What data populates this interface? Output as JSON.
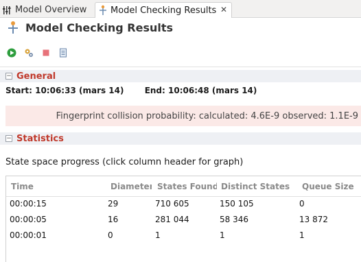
{
  "tabs": [
    {
      "label": "Model Overview",
      "icon": "model-overview-icon",
      "active": false
    },
    {
      "label": "Model Checking Results",
      "icon": "model-checking-icon",
      "active": true,
      "close": "✕"
    }
  ],
  "title": "Model Checking Results",
  "toolbar": [
    "run-icon",
    "settings-icon",
    "stop-icon",
    "document-icon"
  ],
  "general": {
    "header": "General",
    "toggle": "−",
    "start": "Start: 10:06:33 (mars 14)",
    "end": "End: 10:06:48 (mars 14)",
    "fingerprint": "Fingerprint collision probability: calculated: 4.6E-9  observed: 1.1E-9"
  },
  "statistics": {
    "header": "Statistics",
    "toggle": "−",
    "progress_label": "State space progress (click column header for graph)",
    "columns": [
      "Time",
      "Diameter",
      "States Found",
      "Distinct States",
      "Queue Size"
    ],
    "rows": [
      [
        "00:00:15",
        "29",
        "710 605",
        "150 105",
        "0"
      ],
      [
        "00:00:05",
        "16",
        "281 044",
        "58 346",
        "13 872"
      ],
      [
        "00:00:01",
        "0",
        "1",
        "1",
        "1"
      ]
    ]
  },
  "colors": {
    "accent": "#c0392b",
    "section_bg": "#eef0f4",
    "fingerprint_bg": "#fbe9e7"
  }
}
